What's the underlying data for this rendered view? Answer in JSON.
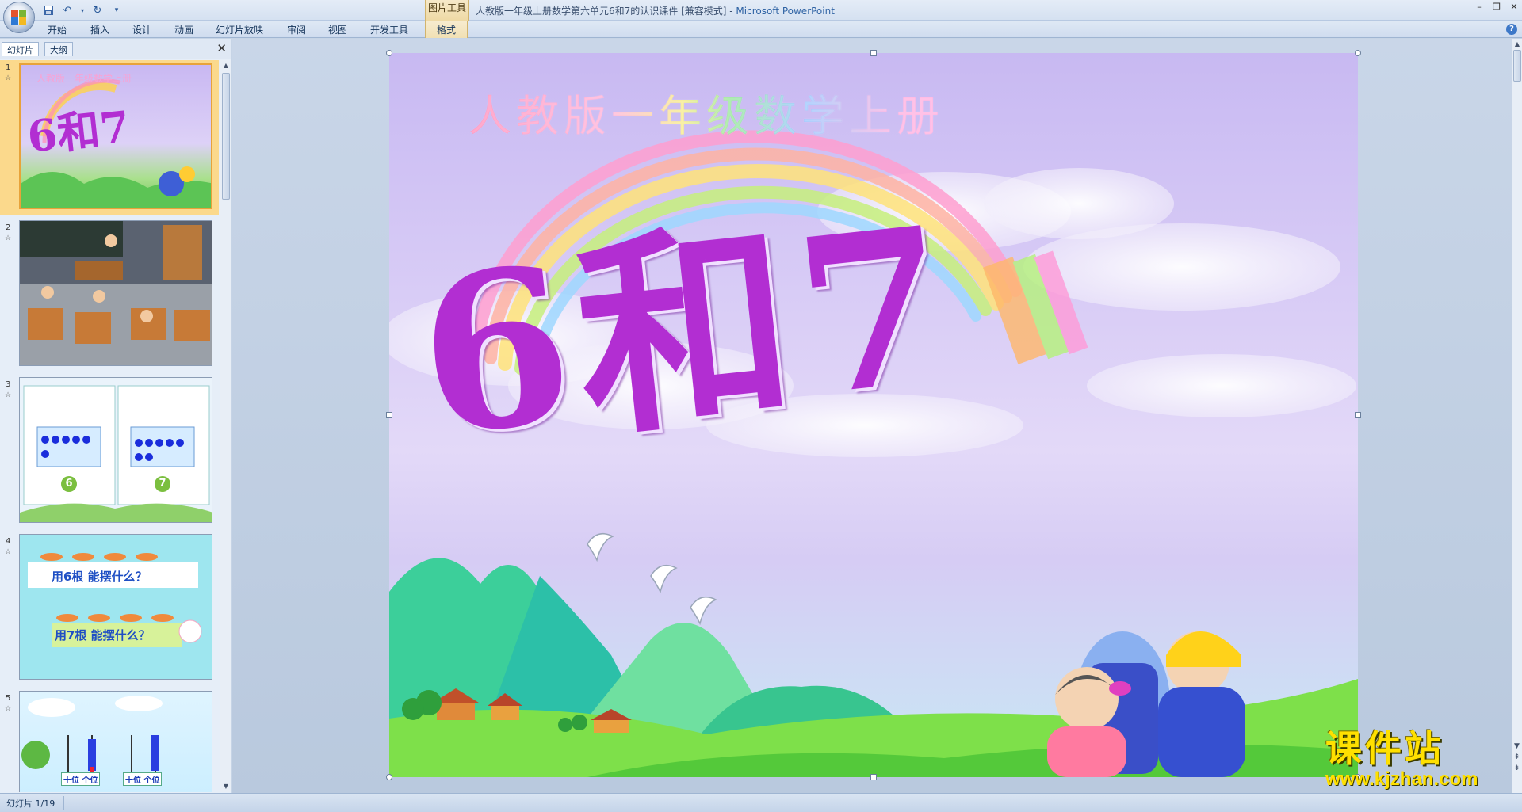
{
  "window": {
    "title": "人教版一年级上册数学第六单元6和7的认识课件 [兼容模式] - ",
    "app_name": "Microsoft PowerPoint",
    "context_tab_group": "图片工具"
  },
  "ribbon": {
    "tabs": [
      "开始",
      "插入",
      "设计",
      "动画",
      "幻灯片放映",
      "审阅",
      "视图",
      "开发工具",
      "格式"
    ],
    "active_context_tab": "格式"
  },
  "panel": {
    "tabs": [
      "幻灯片",
      "大纲"
    ],
    "active_tab": "幻灯片"
  },
  "thumbnails": [
    {
      "number": "1",
      "selected": true,
      "title": "6和7",
      "subtitle": "人教版一年级数学上册"
    },
    {
      "number": "2",
      "selected": false
    },
    {
      "number": "3",
      "selected": false,
      "label_left": "6",
      "label_right": "7"
    },
    {
      "number": "4",
      "selected": false,
      "line1": "用6根  能摆什么？",
      "line2": "用7根  能摆什么？"
    },
    {
      "number": "5",
      "selected": false,
      "label_left": "十位 个位",
      "label_right": "十位 个位"
    }
  ],
  "slide": {
    "subtitle": "人教版一年级数学上册",
    "title": "6和7"
  },
  "status": {
    "slide_indicator": "幻灯片 1/19"
  },
  "watermark": {
    "text": "课件站",
    "url": "www.kjzhan.com"
  },
  "colors": {
    "title_purple": "#b22ed2",
    "selection_orange": "#fbd98c",
    "watermark_yellow": "#ffe000"
  }
}
